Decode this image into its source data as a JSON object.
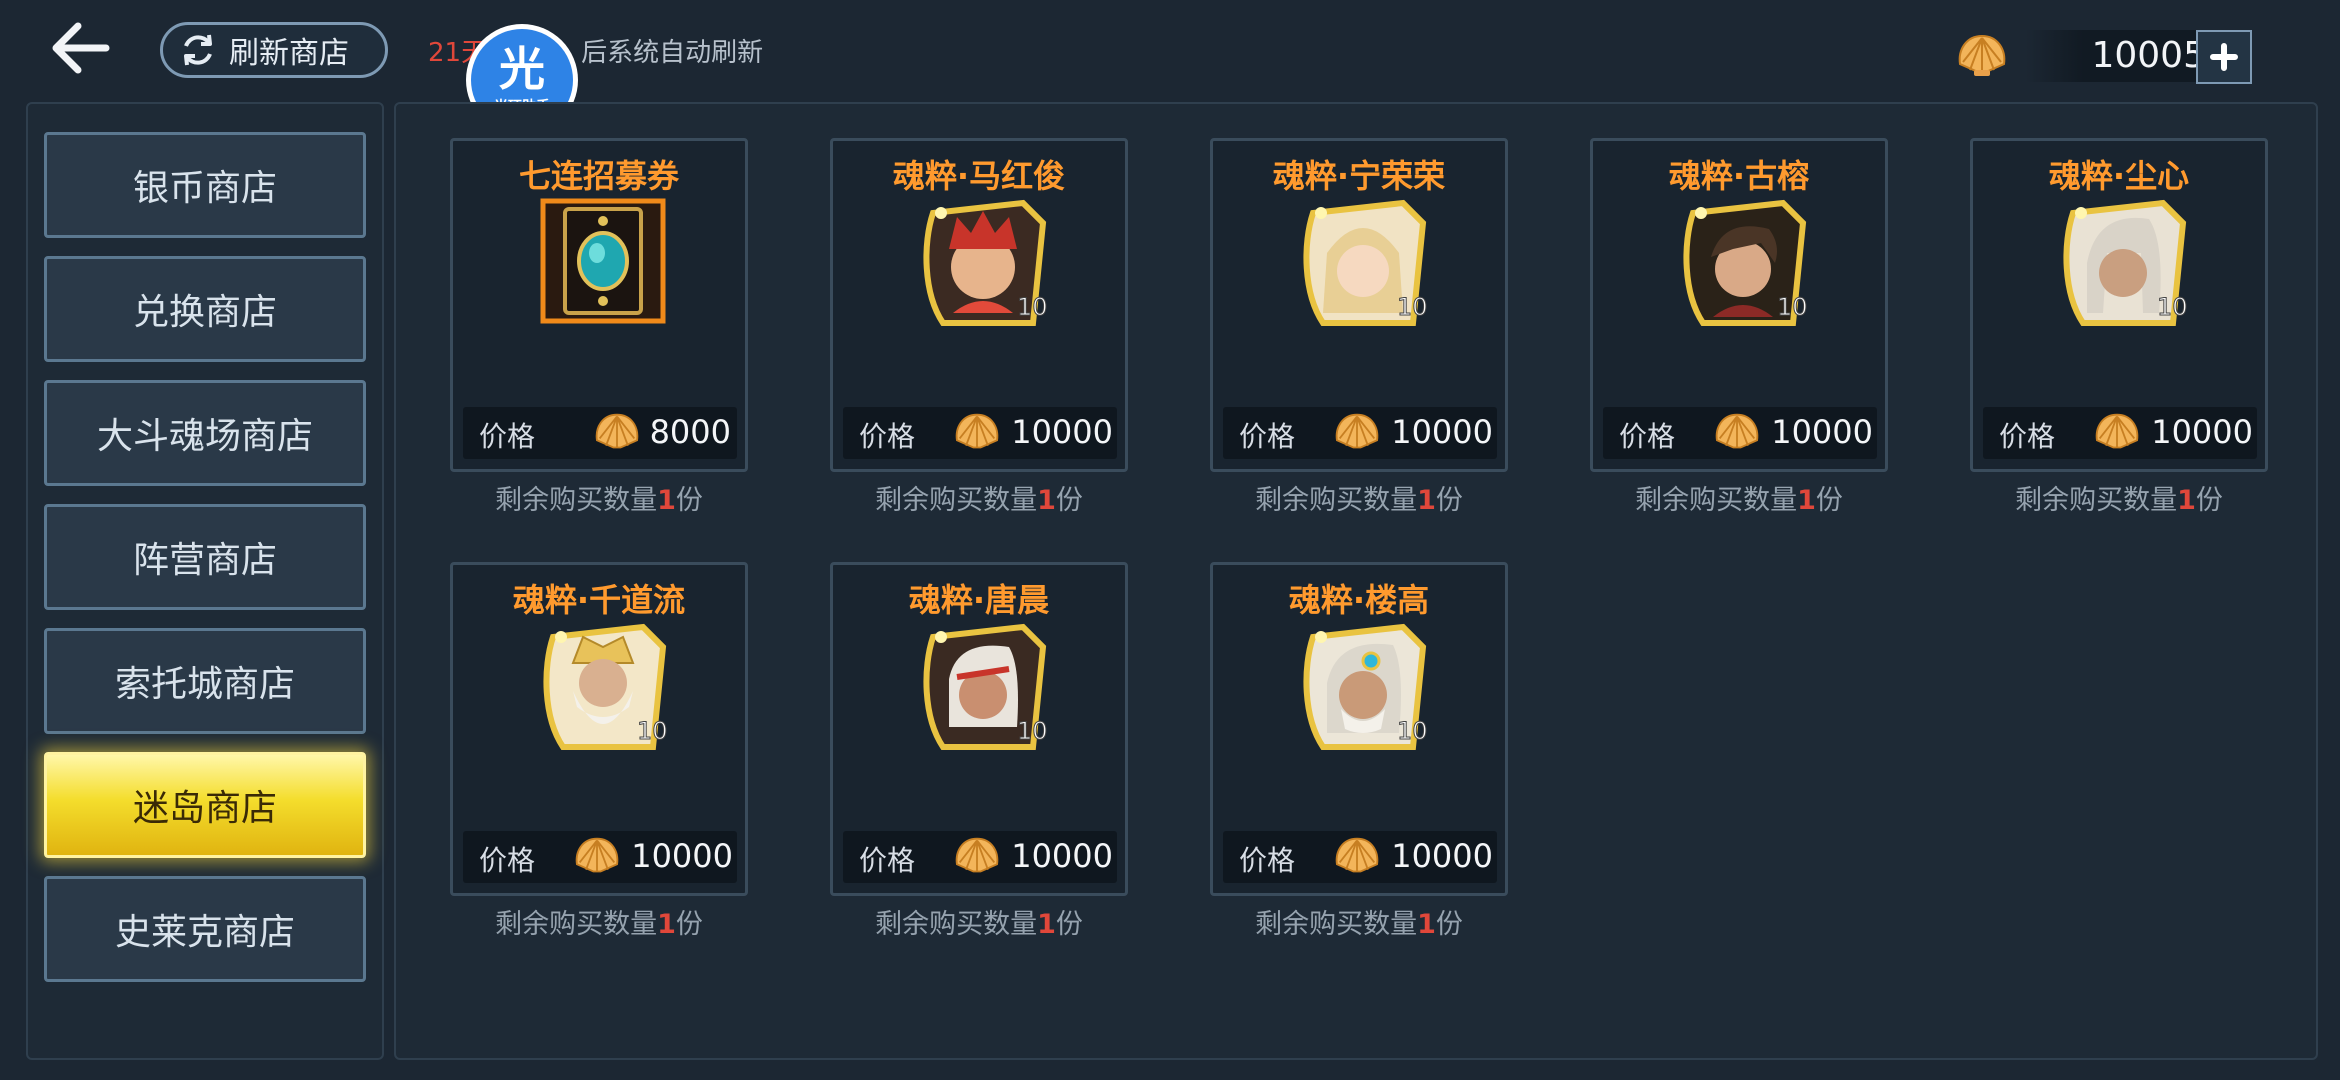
{
  "header": {
    "refresh_button": "刷新商店",
    "refresh_note_prefix": "21天",
    "refresh_note_suffix": "后系统自动刷新",
    "currency_amount": "10005",
    "currency_icon": "shell-icon",
    "accent": "#ff9a2e"
  },
  "watermark": {
    "big": "光",
    "small": "光环助手"
  },
  "sidebar": {
    "items": [
      {
        "label": "银币商店"
      },
      {
        "label": "兑换商店"
      },
      {
        "label": "大斗魂场商店"
      },
      {
        "label": "阵营商店"
      },
      {
        "label": "索托城商店"
      },
      {
        "label": "迷岛商店",
        "active": true
      },
      {
        "label": "史莱克商店"
      }
    ]
  },
  "shop": {
    "price_label": "价格",
    "remain_prefix": "剩余购买数量",
    "remain_suffix": "份",
    "items": [
      {
        "name": "七连招募券",
        "price": "8000",
        "remaining": "1",
        "icon": "recruit-ticket-icon"
      },
      {
        "name": "魂粹·马红俊",
        "price": "10000",
        "remaining": "1",
        "badge": "10",
        "icon": "portrait-ma-hongjun"
      },
      {
        "name": "魂粹·宁荣荣",
        "price": "10000",
        "remaining": "1",
        "badge": "10",
        "icon": "portrait-ning-rongrong"
      },
      {
        "name": "魂粹·古榕",
        "price": "10000",
        "remaining": "1",
        "badge": "10",
        "icon": "portrait-gu-rong"
      },
      {
        "name": "魂粹·尘心",
        "price": "10000",
        "remaining": "1",
        "badge": "10",
        "icon": "portrait-chen-xin"
      },
      {
        "name": "魂粹·千道流",
        "price": "10000",
        "remaining": "1",
        "badge": "10",
        "icon": "portrait-qian-daoliu"
      },
      {
        "name": "魂粹·唐晨",
        "price": "10000",
        "remaining": "1",
        "badge": "10",
        "icon": "portrait-tang-chen"
      },
      {
        "name": "魂粹·楼高",
        "price": "10000",
        "remaining": "1",
        "badge": "10",
        "icon": "portrait-lou-gao"
      }
    ]
  }
}
